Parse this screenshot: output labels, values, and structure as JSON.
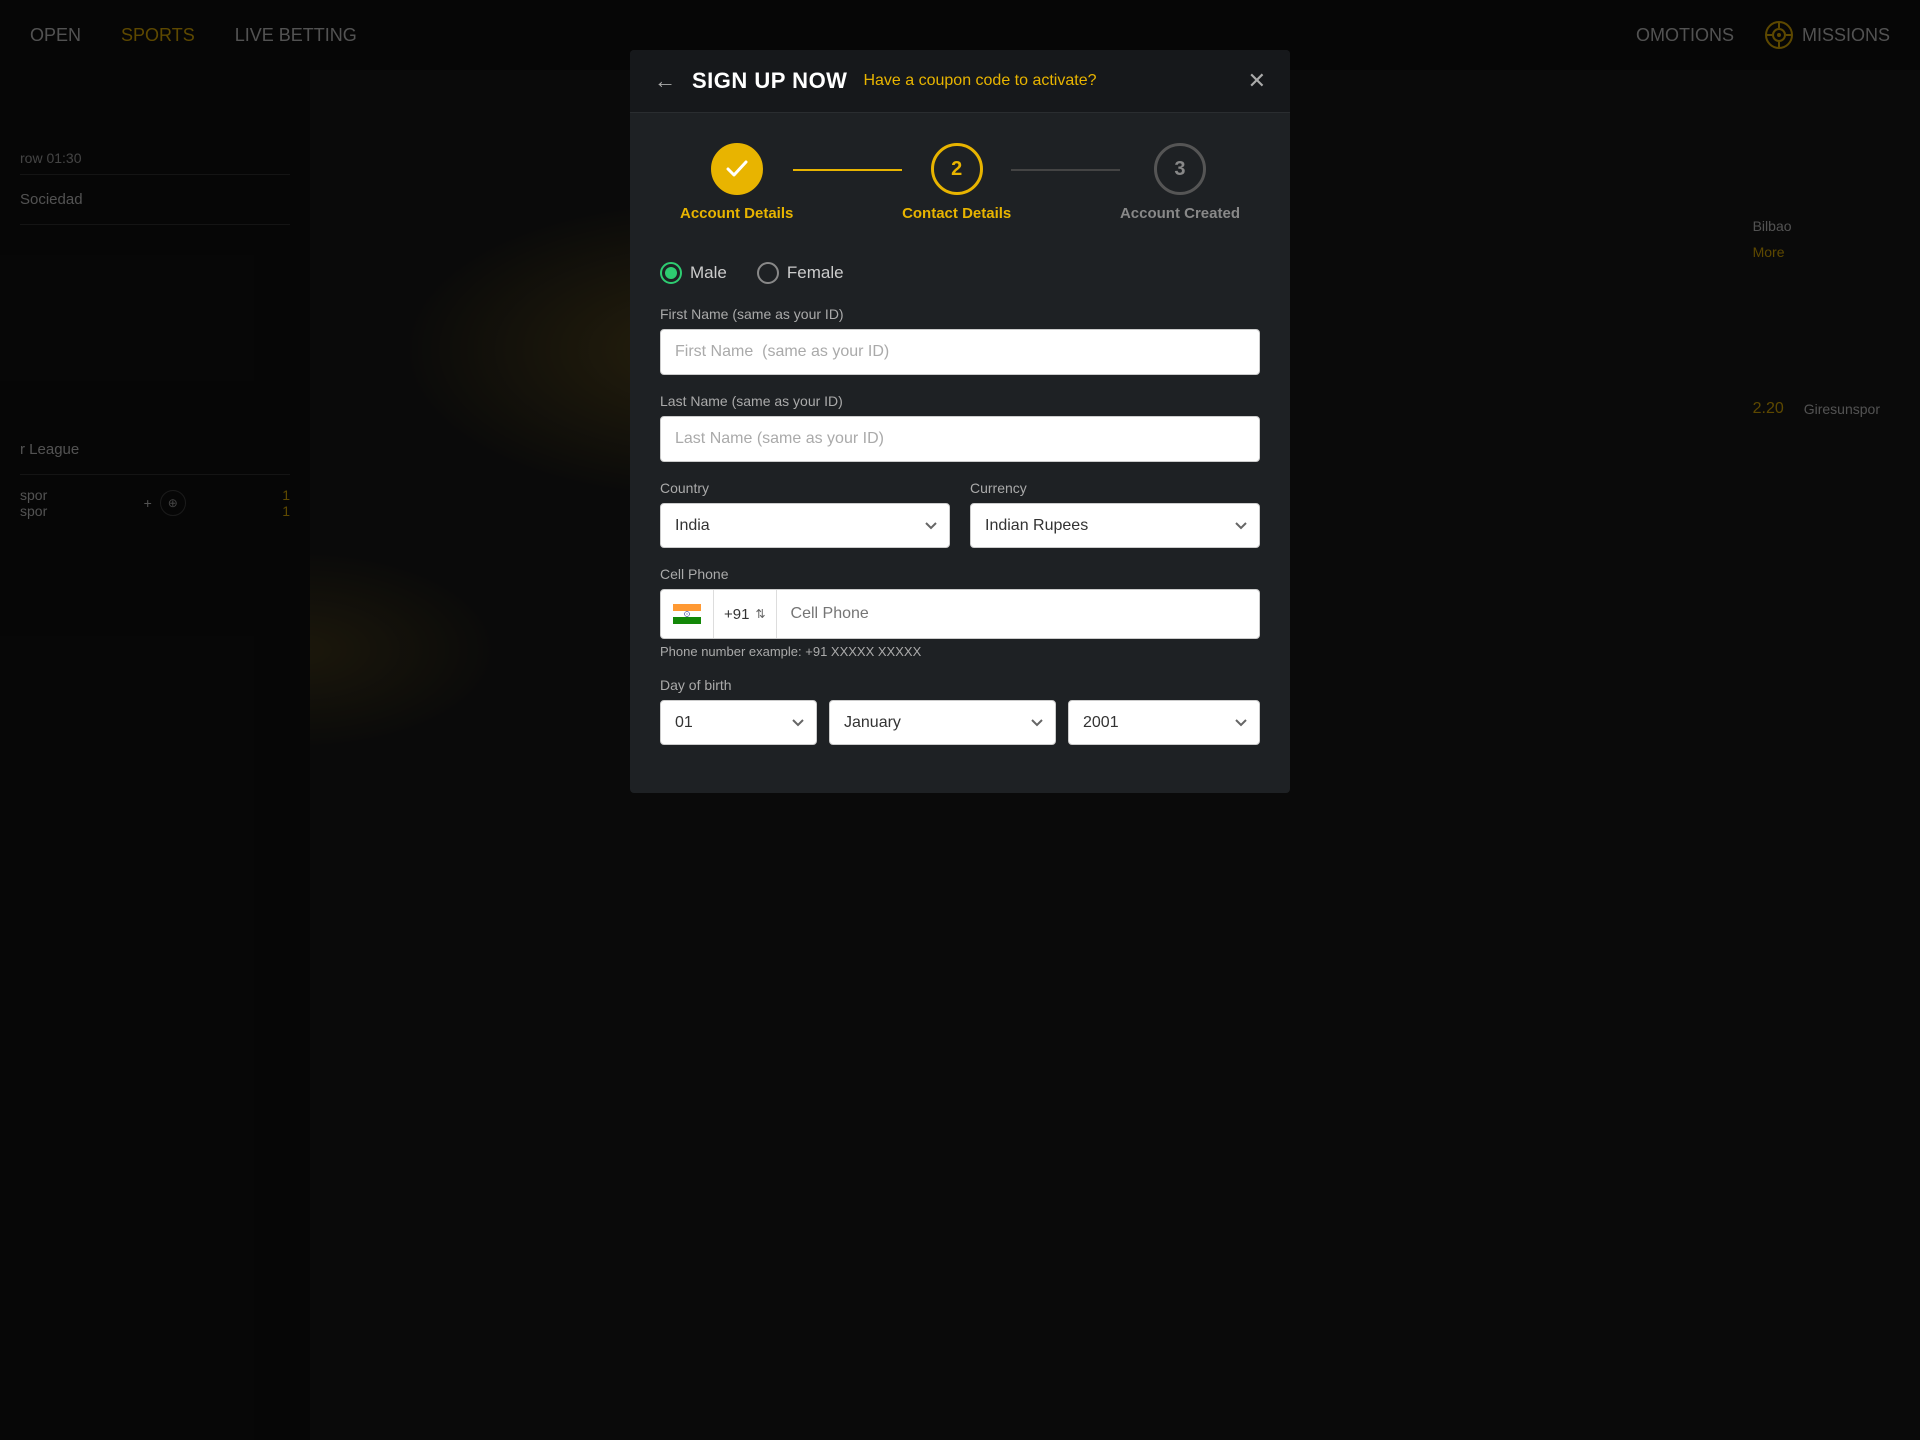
{
  "nav": {
    "items": [
      "OPEN",
      "SPORTS",
      "LIVE BETTING"
    ],
    "right_items": [
      "OMOTIONS",
      "MISSIONS"
    ]
  },
  "modal": {
    "back_icon": "←",
    "title": "SIGN UP NOW",
    "coupon_text": "Have a coupon code to activate?",
    "close_icon": "✕",
    "stepper": {
      "steps": [
        {
          "number": "✓",
          "label": "Account Details",
          "state": "completed"
        },
        {
          "number": "2",
          "label": "Contact Details",
          "state": "active"
        },
        {
          "number": "3",
          "label": "Account Created",
          "state": "inactive"
        }
      ]
    },
    "gender": {
      "options": [
        "Male",
        "Female"
      ],
      "selected": "Male"
    },
    "fields": {
      "first_name_label": "First Name (same as your ID)",
      "first_name_placeholder": "First Name  (same as your ID)",
      "last_name_label": "Last Name (same as your ID)",
      "last_name_placeholder": "Last Name (same as your ID)",
      "country_label": "Country",
      "country_value": "India",
      "currency_label": "Currency",
      "currency_value": "Indian Rupees",
      "phone_label": "Cell Phone",
      "phone_code": "+91",
      "phone_placeholder": "Cell Phone",
      "phone_hint": "Phone number example: +91 XXXXX XXXXX",
      "dob_label": "Day of birth",
      "dob_day": "01",
      "dob_month": "January",
      "dob_year": "2001"
    }
  },
  "sidebar": {
    "time": "row 01:30",
    "team1": "Sociedad",
    "team2": "",
    "league": "r League",
    "match1_t1": "spor",
    "match1_t2": "spor",
    "match1_score1": "1",
    "match1_score2": "1",
    "match2_odds": "2.20",
    "match2_team": "Giresunspor",
    "more": "More",
    "bilbao": "Bilbao"
  }
}
